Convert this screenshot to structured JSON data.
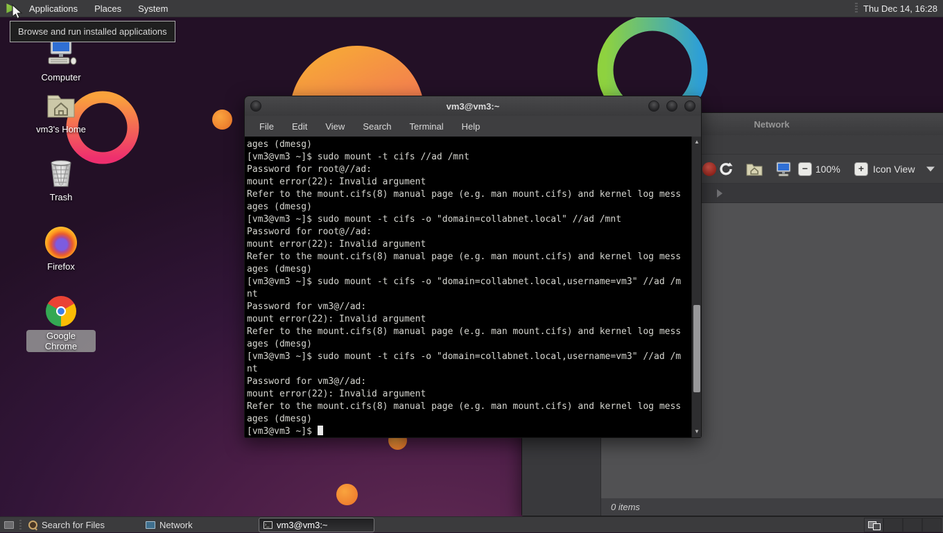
{
  "panel": {
    "menus": {
      "applications": "Applications",
      "places": "Places",
      "system": "System"
    },
    "clock": "Thu Dec 14, 16:28"
  },
  "tooltip": {
    "text": "Browse and run installed applications"
  },
  "desktop": {
    "icons": [
      {
        "label": "Computer"
      },
      {
        "label": "vm3's Home"
      },
      {
        "label": "Trash"
      },
      {
        "label": "Firefox"
      },
      {
        "label": "Google Chrome"
      }
    ]
  },
  "terminal": {
    "title": "vm3@vm3:~",
    "menus": [
      "File",
      "Edit",
      "View",
      "Search",
      "Terminal",
      "Help"
    ],
    "lines": [
      "ages (dmesg)",
      "[vm3@vm3 ~]$ sudo mount -t cifs //ad /mnt",
      "Password for root@//ad:",
      "mount error(22): Invalid argument",
      "Refer to the mount.cifs(8) manual page (e.g. man mount.cifs) and kernel log mess",
      "ages (dmesg)",
      "[vm3@vm3 ~]$ sudo mount -t cifs -o \"domain=collabnet.local\" //ad /mnt",
      "Password for root@//ad:",
      "mount error(22): Invalid argument",
      "Refer to the mount.cifs(8) manual page (e.g. man mount.cifs) and kernel log mess",
      "ages (dmesg)",
      "[vm3@vm3 ~]$ sudo mount -t cifs -o \"domain=collabnet.local,username=vm3\" //ad /m",
      "nt",
      "Password for vm3@//ad:",
      "mount error(22): Invalid argument",
      "Refer to the mount.cifs(8) manual page (e.g. man mount.cifs) and kernel log mess",
      "ages (dmesg)",
      "[vm3@vm3 ~]$ sudo mount -t cifs -o \"domain=collabnet.local,username=vm3\" //ad /m",
      "nt",
      "Password for vm3@//ad:",
      "mount error(22): Invalid argument",
      "Refer to the mount.cifs(8) manual page (e.g. man mount.cifs) and kernel log mess",
      "ages (dmesg)"
    ],
    "prompt": "[vm3@vm3 ~]$ "
  },
  "file_manager": {
    "title": "Network",
    "toolbar": {
      "zoom_level": "100%",
      "view_mode": "Icon View"
    },
    "status": "0 items"
  },
  "taskbar": {
    "tasks": {
      "search": "Search for Files",
      "network": "Network",
      "terminal": "vm3@vm3:~"
    }
  },
  "colors": {
    "panel_bg": "#3b3b3d",
    "wallpaper_top": "#231026",
    "wallpaper_glow": "#632b55",
    "sun_orange": "#f6a33a",
    "ring_green": "#8ed23f",
    "ring_blue": "#2e9fd6",
    "ring_pink": "#ee2f6e",
    "terminal_bg": "#000000",
    "terminal_text": "#d6d6d0",
    "stop_red": "#b03a2e"
  }
}
